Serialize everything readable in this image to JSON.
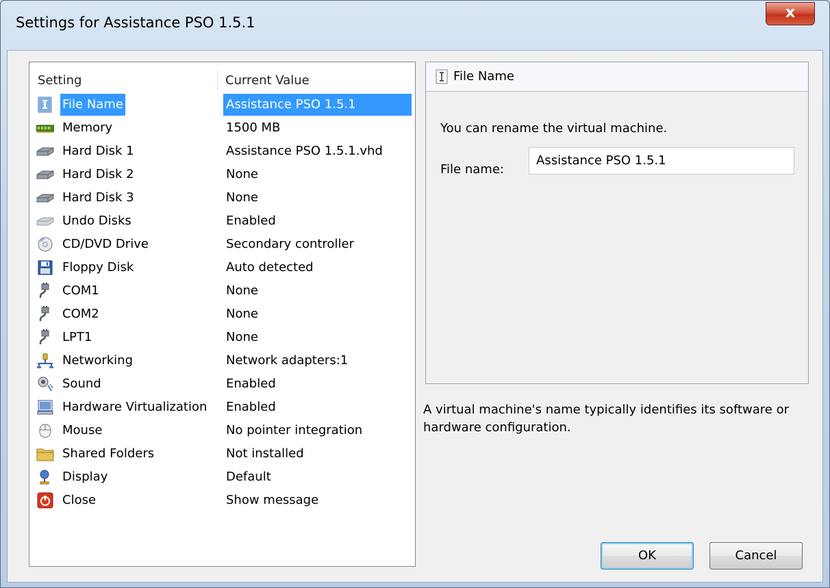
{
  "window": {
    "title": "Settings for Assistance PSO 1.5.1",
    "close_label": "x"
  },
  "list": {
    "header_setting": "Setting",
    "header_value": "Current Value",
    "rows": [
      {
        "label": "File Name",
        "value": "Assistance PSO 1.5.1",
        "icon": "file-name-icon",
        "selected": true
      },
      {
        "label": "Memory",
        "value": "1500 MB",
        "icon": "memory-icon"
      },
      {
        "label": "Hard Disk 1",
        "value": "Assistance PSO 1.5.1.vhd",
        "icon": "hard-disk-icon"
      },
      {
        "label": "Hard Disk 2",
        "value": "None",
        "icon": "hard-disk-icon"
      },
      {
        "label": "Hard Disk 3",
        "value": "None",
        "icon": "hard-disk-icon"
      },
      {
        "label": "Undo Disks",
        "value": "Enabled",
        "icon": "undo-disks-icon"
      },
      {
        "label": "CD/DVD Drive",
        "value": "Secondary controller",
        "icon": "cd-dvd-icon"
      },
      {
        "label": "Floppy Disk",
        "value": "Auto detected",
        "icon": "floppy-disk-icon"
      },
      {
        "label": "COM1",
        "value": "None",
        "icon": "com-port-icon"
      },
      {
        "label": "COM2",
        "value": "None",
        "icon": "com-port-icon"
      },
      {
        "label": "LPT1",
        "value": "None",
        "icon": "com-port-icon"
      },
      {
        "label": "Networking",
        "value": "Network adapters:1",
        "icon": "networking-icon"
      },
      {
        "label": "Sound",
        "value": "Enabled",
        "icon": "sound-icon"
      },
      {
        "label": "Hardware Virtualization",
        "value": "Enabled",
        "icon": "hardware-virtualization-icon"
      },
      {
        "label": "Mouse",
        "value": "No pointer integration",
        "icon": "mouse-icon"
      },
      {
        "label": "Shared Folders",
        "value": "Not installed",
        "icon": "folder-icon"
      },
      {
        "label": "Display",
        "value": "Default",
        "icon": "display-icon"
      },
      {
        "label": "Close",
        "value": "Show message",
        "icon": "close-power-icon"
      }
    ]
  },
  "detail": {
    "title": "File Name",
    "description": "You can rename the virtual machine.",
    "field_label": "File name:",
    "field_value": "Assistance PSO 1.5.1"
  },
  "help_text": "A virtual machine's name typically identifies its software or hardware configuration.",
  "buttons": {
    "ok": "OK",
    "cancel": "Cancel"
  },
  "colors": {
    "selection": "#3399ff",
    "close_button": "#c7432a"
  }
}
